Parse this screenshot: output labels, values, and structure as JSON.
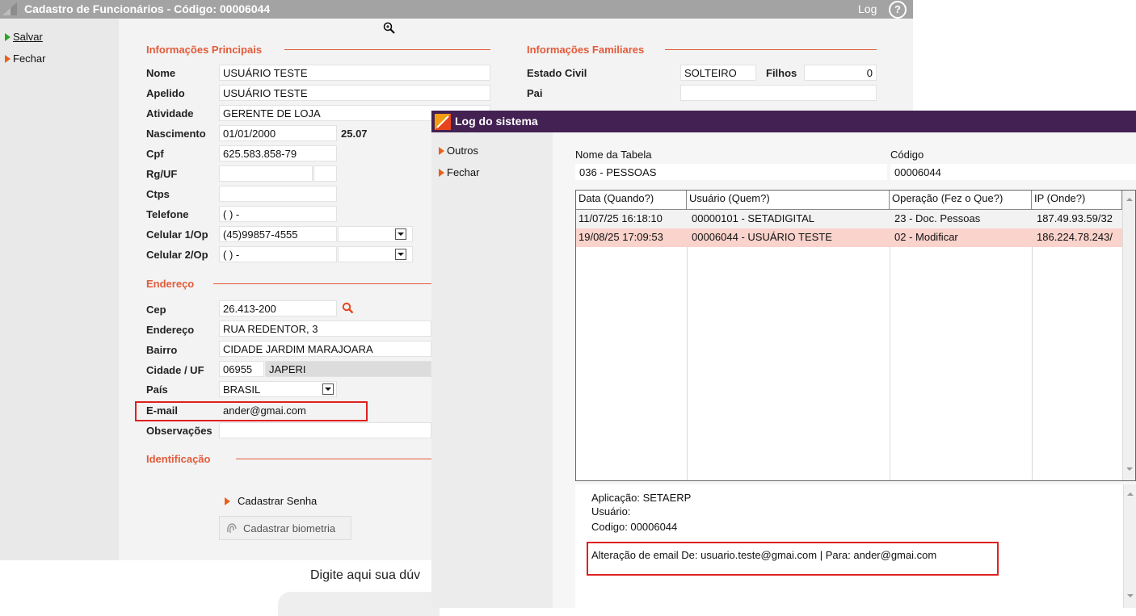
{
  "main_window": {
    "title": "Cadastro de Funcionários - Código: 00006044",
    "log_label": "Log",
    "help_icon": "?",
    "nav": [
      {
        "label": "Salvar",
        "icon": "play-green-icon"
      },
      {
        "label": "Fechar",
        "icon": "play-orange-icon"
      }
    ]
  },
  "principal": {
    "section_title": "Informações Principais",
    "fields": {
      "nome": {
        "label": "Nome",
        "value": "USUÁRIO TESTE"
      },
      "apelido": {
        "label": "Apelido",
        "value": "USUÁRIO TESTE"
      },
      "atividade": {
        "label": "Atividade",
        "value": "GERENTE DE LOJA"
      },
      "nascimento": {
        "label": "Nascimento",
        "value": "01/01/2000",
        "age": "25.07"
      },
      "cpf": {
        "label": "Cpf",
        "value": "625.583.858-79"
      },
      "rg": {
        "label": "Rg/UF",
        "value": ""
      },
      "ctps": {
        "label": "Ctps",
        "value": ""
      },
      "telefone": {
        "label": "Telefone",
        "value": "( )  -"
      },
      "celular1": {
        "label": "Celular 1/Op",
        "value": "(45)99857-4555"
      },
      "celular2": {
        "label": "Celular 2/Op",
        "value": "( )  -"
      }
    }
  },
  "familiar": {
    "section_title": "Informações Familiares",
    "estado_civil": {
      "label": "Estado Civil",
      "value": "SOLTEIRO"
    },
    "filhos": {
      "label": "Filhos",
      "value": "0"
    },
    "pai": {
      "label": "Pai",
      "value": ""
    }
  },
  "endereco": {
    "section_title": "Endereço",
    "cep": {
      "label": "Cep",
      "value": "26.413-200"
    },
    "endereco": {
      "label": "Endereço",
      "value": "RUA REDENTOR, 3"
    },
    "bairro": {
      "label": "Bairro",
      "value": "CIDADE JARDIM MARAJOARA"
    },
    "cidade": {
      "label": "Cidade / UF",
      "code": "06955",
      "name": "JAPERI"
    },
    "pais": {
      "label": "País",
      "value": "BRASIL"
    },
    "email": {
      "label": "E-mail",
      "value": "ander@gmai.com"
    },
    "observacoes": {
      "label": "Observações",
      "value": ""
    }
  },
  "identificacao": {
    "section_title": "Identificação",
    "cadastrar_senha": "Cadastrar Senha",
    "cadastrar_biometria": "Cadastrar biometria"
  },
  "behind_text": "Digite aqui sua dúv",
  "log_dialog": {
    "title": "Log do sistema",
    "nav": [
      {
        "label": "Outros",
        "icon": "play-orange-icon"
      },
      {
        "label": "Fechar",
        "icon": "play-orange-icon"
      }
    ],
    "table_name_label": "Nome da Tabela",
    "table_name_value": "036 - PESSOAS",
    "code_label": "Código",
    "code_value": "00006044",
    "columns": [
      "Data (Quando?)",
      "Usuário (Quem?)",
      "Operação (Fez o Que?)",
      "IP (Onde?)"
    ],
    "rows": [
      {
        "data": "11/07/25 16:18:10",
        "usuario": "00000101 - SETADIGITAL",
        "operacao": "23 - Doc. Pessoas",
        "ip": "187.49.93.59/32"
      },
      {
        "data": "19/08/25 17:09:53",
        "usuario": "00006044 - USUÁRIO TESTE",
        "operacao": "02 - Modificar",
        "ip": "186.224.78.243/"
      }
    ],
    "details": {
      "aplicacao": "Aplicação: SETAERP",
      "usuario": "Usuário:",
      "codigo": "Codigo: 00006044",
      "alteracao": "Alteração de email De: usuario.teste@gmai.com | Para: ander@gmai.com"
    }
  },
  "colors": {
    "title_bar": "#a3a3a3",
    "log_title_bar": "#432152",
    "section_accent": "#e35a3a",
    "selected_row": "#f9d3cc",
    "highlight_box": "#e02020"
  }
}
